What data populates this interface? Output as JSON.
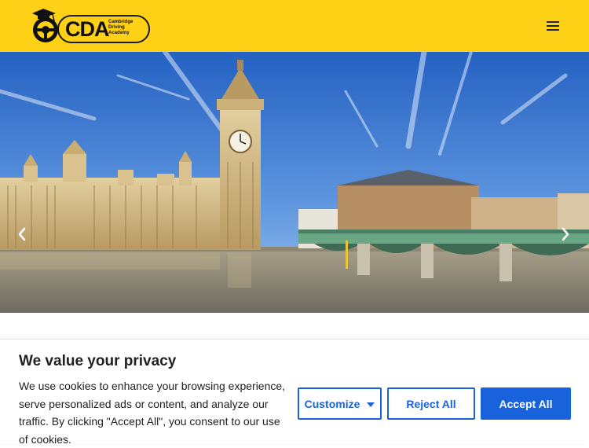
{
  "header": {
    "logo_text": "CDA",
    "logo_subtitle": [
      "Cambridge",
      "Driving",
      "Academy"
    ],
    "menu_icon": "hamburger-menu-icon",
    "background_color": "#FFD116"
  },
  "hero": {
    "image_alt": "Houses of Parliament and Big Ben beside Westminster Bridge under a blue sky",
    "prev_icon": "chevron-left-icon",
    "next_icon": "chevron-right-icon"
  },
  "cookie_banner": {
    "title": "We value your privacy",
    "body": "We use cookies to enhance your browsing experience, serve personalized ads or content, and analyze our traffic. By clicking \"Accept All\", you consent to our use of cookies.",
    "customize_label": "Customize",
    "reject_label": "Reject All",
    "accept_label": "Accept All",
    "accent_color": "#1863DC"
  }
}
